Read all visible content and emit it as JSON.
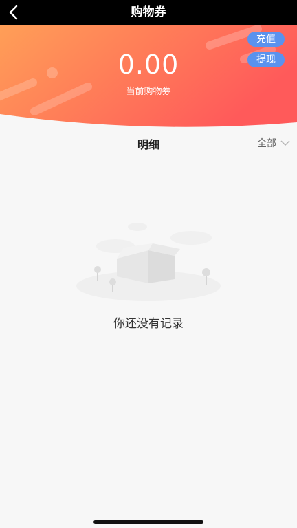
{
  "topbar": {
    "title": "购物券",
    "back_icon": "chevron-left-icon"
  },
  "header": {
    "balance": "0.00",
    "balance_label": "当前购物券",
    "recharge_label": "充值",
    "withdraw_label": "提现",
    "gradient_from": "#ff9f57",
    "gradient_to": "#ff5a5a",
    "pill_color": "#5a92ee"
  },
  "details": {
    "title": "明细",
    "filter_label": "全部",
    "filter_icon": "chevron-down-icon"
  },
  "empty": {
    "message": "你还没有记录",
    "illustration_icon": "empty-box-icon"
  }
}
